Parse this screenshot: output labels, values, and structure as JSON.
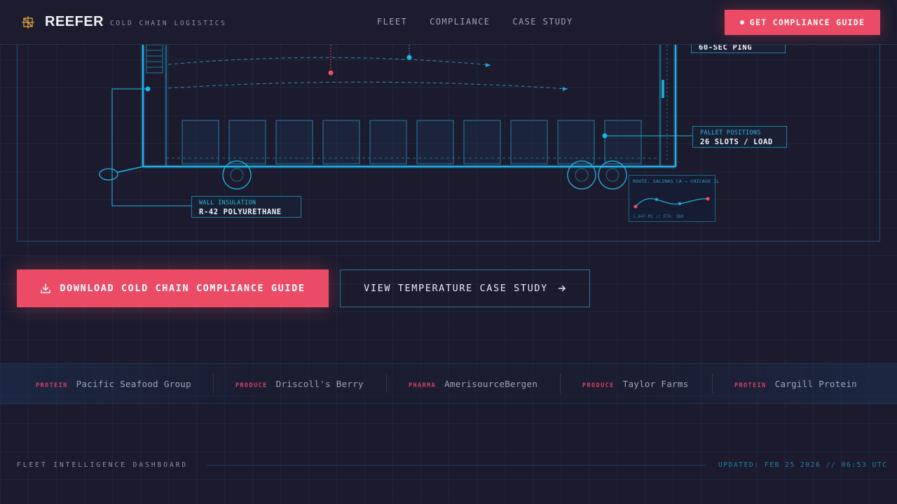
{
  "header": {
    "brand": "REEFER",
    "tagline": "COLD CHAIN LOGISTICS",
    "nav": [
      "FLEET",
      "COMPLIANCE",
      "CASE STUDY"
    ],
    "cta_label": "GET COMPLIANCE GUIDE"
  },
  "diagram": {
    "callouts": {
      "ping": {
        "value": "60-SEC PING"
      },
      "pallet": {
        "label": "PALLET POSITIONS",
        "value": "26 SLOTS / LOAD"
      },
      "insulation": {
        "label": "WALL INSULATION",
        "value": "R-42 POLYURETHANE"
      }
    },
    "route": {
      "title": "ROUTE: SALINAS CA → CHICAGO IL",
      "meta": "1,847 MI // ETA: 38H"
    }
  },
  "actions": {
    "primary_label": "DOWNLOAD COLD CHAIN COMPLIANCE GUIDE",
    "secondary_label": "VIEW TEMPERATURE CASE STUDY"
  },
  "clients": [
    {
      "category": "PROTEIN",
      "name": "Pacific Seafood Group"
    },
    {
      "category": "PRODUCE",
      "name": "Driscoll's Berry"
    },
    {
      "category": "PHARMA",
      "name": "AmerisourceBergen"
    },
    {
      "category": "PRODUCE",
      "name": "Taylor Farms"
    },
    {
      "category": "PROTEIN",
      "name": "Cargill Protein"
    }
  ],
  "footer": {
    "dashboard_label": "FLEET INTELLIGENCE DASHBOARD",
    "updated": "UPDATED: FEB 25 2026 // 06:53 UTC"
  },
  "colors": {
    "accent": "#ec4b66",
    "cyan": "#1fb4e6",
    "background": "#1b1b2d"
  },
  "icons": [
    "snowflake-logo-icon",
    "download-icon",
    "arrow-right-icon"
  ]
}
